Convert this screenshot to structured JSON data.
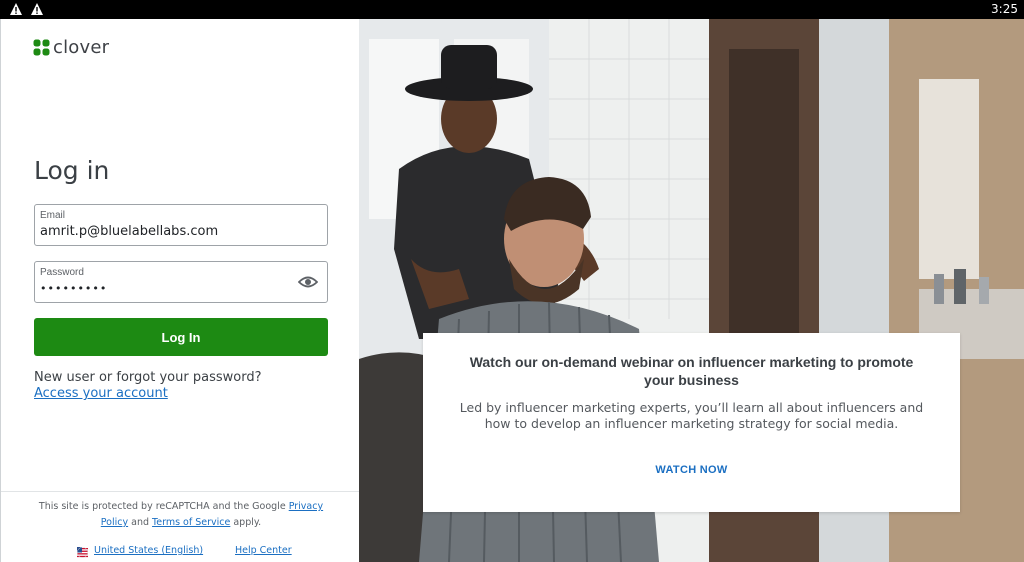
{
  "status_bar": {
    "time": "3:25",
    "icons": [
      "warning-icon",
      "warning-icon"
    ]
  },
  "brand": {
    "name": "clover",
    "accent": "#1d8a13",
    "link": "#1b6fc2"
  },
  "login": {
    "title": "Log in",
    "email_label": "Email",
    "email_value": "amrit.p@bluelabellabs.com",
    "password_label": "Password",
    "password_value": "•••••••••",
    "button": "Log In",
    "forgot_text": "New user or forgot your password?",
    "access_link": "Access your account"
  },
  "recaptcha": {
    "text_before": "This site is protected by reCAPTCHA and the Google ",
    "privacy": "Privacy Policy",
    "text_mid": " and ",
    "terms": "Terms of Service",
    "text_after": " apply."
  },
  "footer": {
    "language": "United States (English)",
    "help": "Help Center"
  },
  "promo": {
    "title": "Watch our on-demand webinar on influencer marketing to promote your business",
    "body": "Led by influencer marketing experts, you’ll learn all about influencers and how to develop an influencer marketing strategy for social media.",
    "cta": "WATCH NOW"
  }
}
